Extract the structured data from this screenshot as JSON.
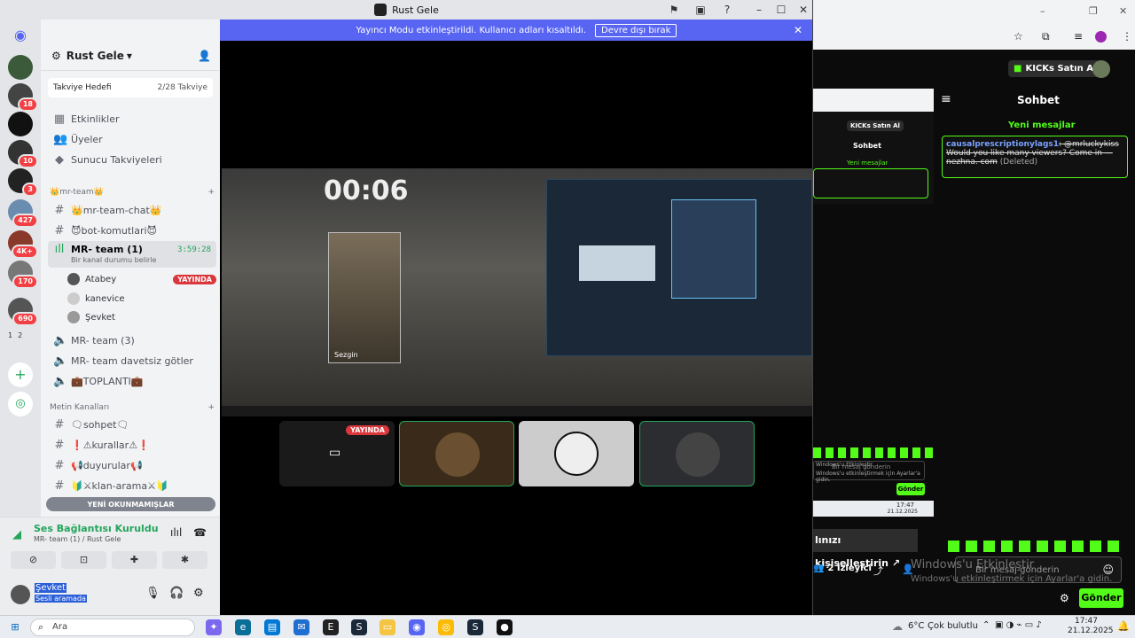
{
  "window_title": "Rust Gele",
  "streamer_bar": {
    "message": "Yayıncı Modu etkinleştirildi. Kullanıcı adları kısaltıldı.",
    "button": "Devre dışı bırak"
  },
  "servers": {
    "badges": [
      "18",
      "10",
      "3",
      "427",
      "4K+",
      "170",
      "690"
    ],
    "page": [
      "1",
      "2"
    ]
  },
  "guild": {
    "name": "Rust Gele",
    "boost_label": "Takviye Hedefi",
    "boost_value": "2/28 Takviye"
  },
  "menu": [
    "Etkinlikler",
    "Üyeler",
    "Sunucu Takviyeleri"
  ],
  "category1": "👑mr-team👑",
  "channels1": [
    {
      "icon": "#",
      "label": "👑mr-team-chat👑"
    },
    {
      "icon": "#",
      "label": "😈bot-komutlari😈"
    }
  ],
  "active_voice": {
    "label": "MR- team (1)",
    "timer": "3:59:28",
    "status": "Bir kanal durumu belirle"
  },
  "voice_users": [
    {
      "name": "Atabey",
      "live": "YAYINDA"
    },
    {
      "name": "kanevice",
      "live": ""
    },
    {
      "name": "Şevket",
      "live": ""
    }
  ],
  "voice_channels": [
    {
      "label": "MR- team (3)"
    },
    {
      "label": "MR- team davetsiz götler"
    },
    {
      "label": "💼TOPLANTI💼"
    }
  ],
  "category2": "Metin Kanalları",
  "channels2": [
    {
      "icon": "#",
      "label": "🗨sohpet🗨"
    },
    {
      "icon": "#",
      "label": "❗⚠kurallar⚠❗"
    },
    {
      "icon": "#",
      "label": "📢duyurular📢"
    },
    {
      "icon": "#",
      "label": "🔰⚔klan-arama⚔🔰"
    }
  ],
  "unread_pill": "YENİ OKUNMAMIŞLAR",
  "voice_panel": {
    "title": "Ses Bağlantısı Kuruldu",
    "subtitle": "MR- team (1) / Rust Gele"
  },
  "user_panel": {
    "name": "Şevket",
    "status": "Sesli aramada"
  },
  "stream": {
    "timer": "00:06",
    "card_name": "Sezgin",
    "live_label": "YAYINDA"
  },
  "kick": {
    "buy_button": "KICKs Satın Al",
    "chat_title": "Sohbet",
    "new_messages": "Yeni mesajlar",
    "message_user": "causalprescriptionylags1",
    "message_text": ": @mrluckykiss Would you like many viewers? Come in — nezhna. com",
    "message_status": "(Deleted)",
    "personalize": "lınızı kişiselleştirin",
    "viewers": "2 İzleyici",
    "send_placeholder": "Bir mesaj gönderin",
    "send_button": "Gönder",
    "watermark_title": "Windows'u Etkinleştir",
    "watermark_sub": "Windows'u etkinleştirmek için Ayarlar'a gidin.",
    "inner_time": "17:47",
    "inner_date": "21.12.2025"
  },
  "taskbar": {
    "search": "Ara",
    "weather_temp": "6°C",
    "weather_text": "Çok bulutlu",
    "time": "17:47",
    "date": "21.12.2025"
  },
  "colors": {
    "discord_blurple": "#5865f2",
    "kick_green": "#53fc18",
    "live_red": "#da373c"
  }
}
